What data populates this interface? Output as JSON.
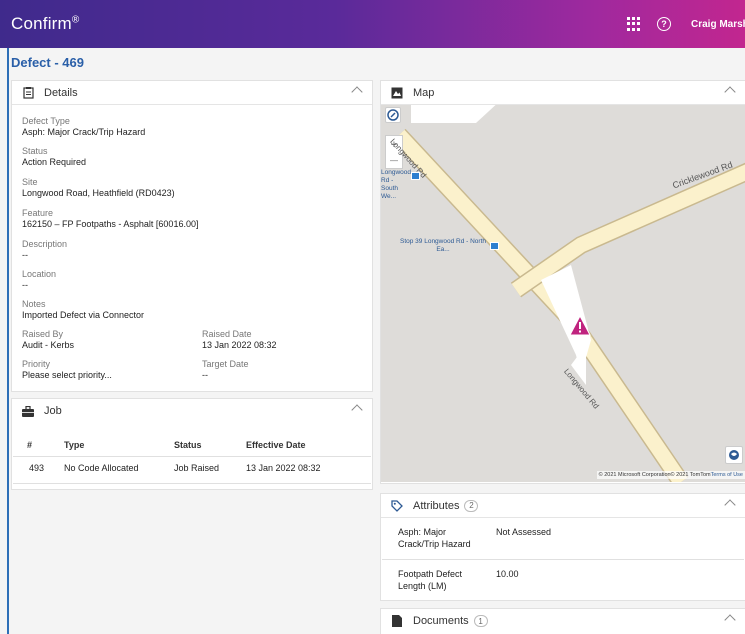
{
  "header": {
    "brand": "Confirm",
    "brand_mark": "®",
    "user": "Craig Marshall"
  },
  "page": {
    "title": "Defect - 469"
  },
  "details": {
    "title": "Details",
    "fields": [
      {
        "label": "Defect Type",
        "value": "Asph: Major Crack/Trip Hazard"
      },
      {
        "label": "Status",
        "value": "Action Required"
      },
      {
        "label": "Site",
        "value": "Longwood Road, Heathfield (RD0423)"
      },
      {
        "label": "Feature",
        "value": "162150 – FP Footpaths - Asphalt [60016.00]"
      },
      {
        "label": "Description",
        "value": "--"
      },
      {
        "label": "Location",
        "value": "--"
      },
      {
        "label": "Notes",
        "value": "Imported Defect via Connector"
      }
    ],
    "raised_by": {
      "label": "Raised By",
      "value": "Audit - Kerbs"
    },
    "raised_date": {
      "label": "Raised Date",
      "value": "13 Jan 2022 08:32"
    },
    "priority": {
      "label": "Priority",
      "value": "Please select priority..."
    },
    "target_date": {
      "label": "Target Date",
      "value": "--"
    }
  },
  "job": {
    "title": "Job",
    "columns": [
      "#",
      "Type",
      "Status",
      "Effective Date"
    ],
    "rows": [
      [
        "493",
        "No Code Allocated",
        "Job Raised",
        "13 Jan 2022 08:32"
      ]
    ]
  },
  "map": {
    "title": "Map",
    "labels": {
      "longwood_top": "Longwood Rd",
      "stop_left": "Longwood Rd - South We...",
      "cricklewood": "Cricklewood Rd",
      "stop_center": "Stop 39 Longwood Rd - North Ea...",
      "longwood_bottom": "Longwood Rd"
    },
    "zoom_in": "+",
    "zoom_out": "—",
    "copyright": "© 2021 Microsoft Corporation© 2021 TomTom",
    "terms": "Terms of Use"
  },
  "attributes": {
    "title": "Attributes",
    "count": "2",
    "rows": [
      {
        "name": "Asph: Major Crack/Trip Hazard",
        "value": "Not Assessed"
      },
      {
        "name": "Footpath Defect Length (LM)",
        "value": "10.00"
      }
    ]
  },
  "documents": {
    "title": "Documents",
    "count": "1"
  }
}
